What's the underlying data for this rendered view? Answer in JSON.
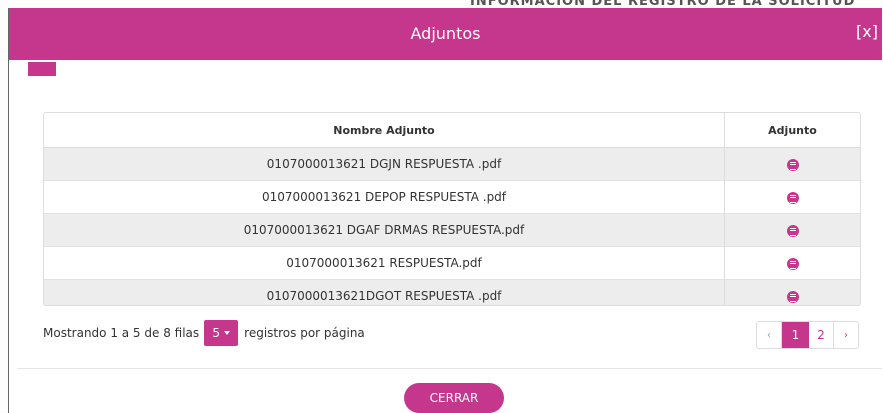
{
  "background": {
    "title": "INFORMACIÓN DEL REGISTRO DE LA SOLICITUD"
  },
  "modal": {
    "title": "Adjuntos",
    "close_label": "[x]"
  },
  "table": {
    "headers": [
      "Nombre Adjunto",
      "Adjunto"
    ],
    "rows": [
      {
        "name": "0107000013621 DGJN RESPUESTA .pdf",
        "icon": "pdf-icon"
      },
      {
        "name": "0107000013621 DEPOP RESPUESTA .pdf",
        "icon": "pdf-icon"
      },
      {
        "name": "0107000013621 DGAF DRMAS RESPUESTA.pdf",
        "icon": "pdf-icon"
      },
      {
        "name": "0107000013621 RESPUESTA.pdf",
        "icon": "pdf-icon"
      },
      {
        "name": "0107000013621DGOT RESPUESTA .pdf",
        "icon": "pdf-icon"
      }
    ]
  },
  "pager": {
    "info_prefix": "Mostrando 1 a 5 de 8 filas",
    "page_size": "5",
    "info_suffix": "registros por página",
    "prev": "‹",
    "pages": [
      "1",
      "2"
    ],
    "next": "›",
    "current_page": "1"
  },
  "footer": {
    "close_button": "CERRAR"
  },
  "colors": {
    "accent": "#c4378c",
    "row_stripe": "#ededed"
  }
}
